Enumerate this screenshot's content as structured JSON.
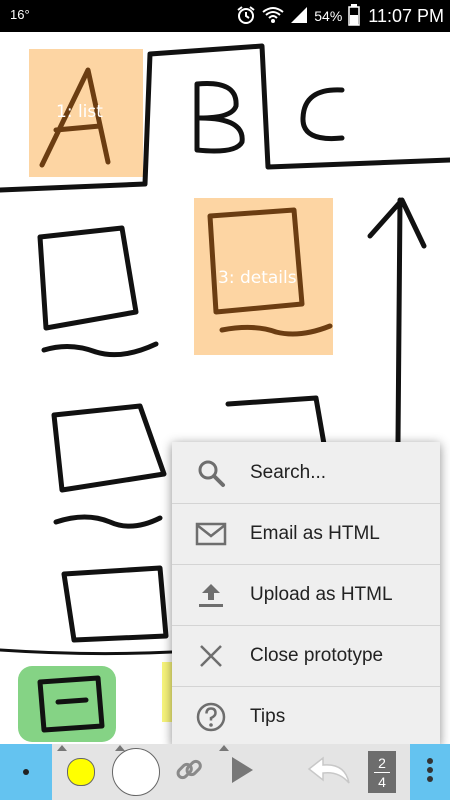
{
  "status_bar": {
    "temperature": "16°",
    "battery": "54%",
    "time": "11:07 PM"
  },
  "canvas": {
    "sketch_letters": [
      "A",
      "B",
      "C"
    ],
    "labels": {
      "list": "1: list",
      "details": "3: details"
    },
    "hotspot_color": "#fdd5a3",
    "green_color": "#2aa82a",
    "yellow_color": "#f6f35a"
  },
  "menu": {
    "items": [
      {
        "label": "Search...",
        "icon": "search-icon"
      },
      {
        "label": "Email as HTML",
        "icon": "email-icon"
      },
      {
        "label": "Upload as HTML",
        "icon": "upload-icon"
      },
      {
        "label": "Close prototype",
        "icon": "close-icon"
      },
      {
        "label": "Tips",
        "icon": "help-icon"
      }
    ]
  },
  "toolbar": {
    "page_current": "2",
    "page_total": "4",
    "pen_color": "#ffff00",
    "accent_color": "#64c3f0"
  }
}
